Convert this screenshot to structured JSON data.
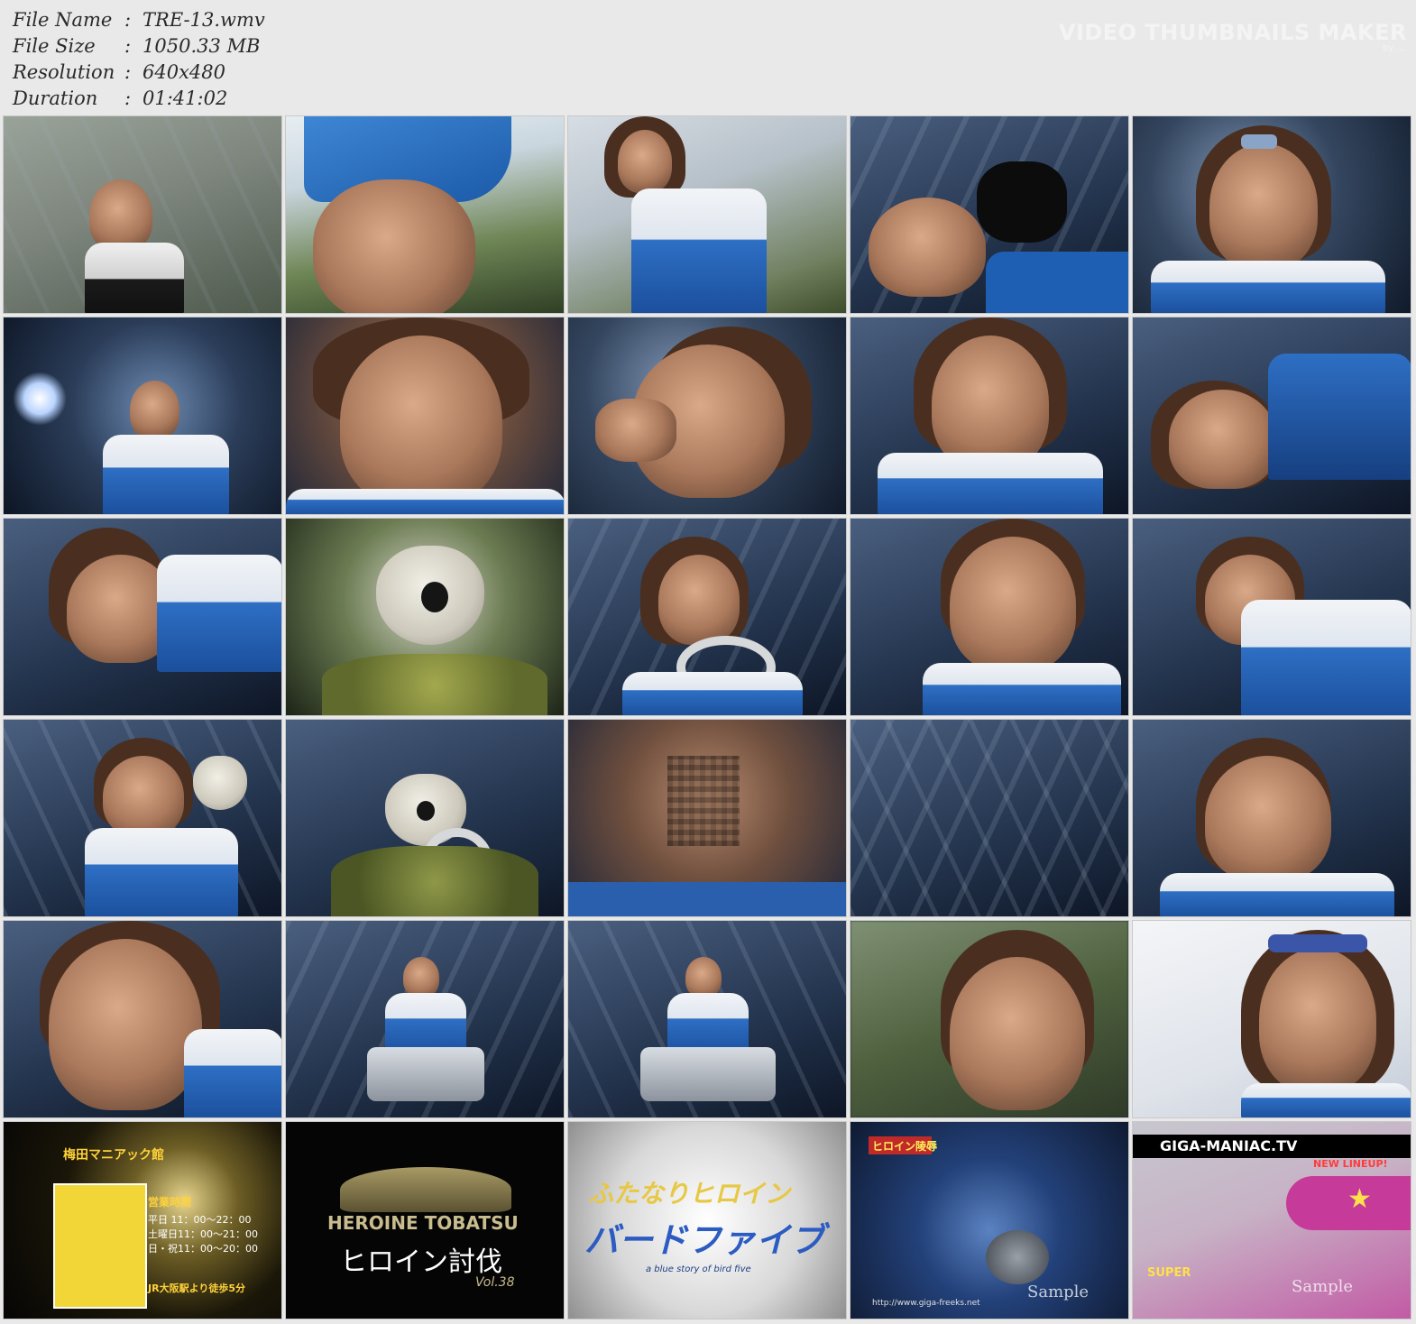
{
  "info": {
    "rows": [
      {
        "label": "File Name",
        "sep": ":",
        "value": "TRE-13.wmv"
      },
      {
        "label": "File Size",
        "sep": ":",
        "value": "1050.33 MB"
      },
      {
        "label": "Resolution",
        "sep": ":",
        "value": "640x480"
      },
      {
        "label": "Duration",
        "sep": ":",
        "value": "01:41:02"
      }
    ]
  },
  "watermark": {
    "title": "VIDEO THUMBNAILS MAKER",
    "subtitle": "by ..."
  },
  "thumbnails": [
    {
      "id": 1,
      "scene": "outdoor-net"
    },
    {
      "id": 2,
      "scene": "outdoor-skirt"
    },
    {
      "id": 3,
      "scene": "outdoor-standing"
    },
    {
      "id": 4,
      "scene": "dark-glove"
    },
    {
      "id": 5,
      "scene": "dark-face"
    },
    {
      "id": 6,
      "scene": "chained-light"
    },
    {
      "id": 7,
      "scene": "face-closeup"
    },
    {
      "id": 8,
      "scene": "face-hand"
    },
    {
      "id": 9,
      "scene": "face-closeup"
    },
    {
      "id": 10,
      "scene": "face-tilted"
    },
    {
      "id": 11,
      "scene": "face-lying"
    },
    {
      "id": 12,
      "scene": "skull-monster"
    },
    {
      "id": 13,
      "scene": "face-hose"
    },
    {
      "id": 14,
      "scene": "face-closeup"
    },
    {
      "id": 15,
      "scene": "face-lying"
    },
    {
      "id": 16,
      "scene": "face-monster"
    },
    {
      "id": 17,
      "scene": "skull-monster"
    },
    {
      "id": 18,
      "scene": "mosaic"
    },
    {
      "id": 19,
      "scene": "cage-bars"
    },
    {
      "id": 20,
      "scene": "face-tilted"
    },
    {
      "id": 21,
      "scene": "face-closeup"
    },
    {
      "id": 22,
      "scene": "cage-seated"
    },
    {
      "id": 23,
      "scene": "cage-seated"
    },
    {
      "id": 24,
      "scene": "outdoor-blur"
    },
    {
      "id": 25,
      "scene": "light-face"
    },
    {
      "id": 26,
      "scene": "map-ad"
    },
    {
      "id": 27,
      "scene": "title-card"
    },
    {
      "id": 28,
      "scene": "title-card-2"
    },
    {
      "id": 29,
      "scene": "sample-closeup"
    },
    {
      "id": 30,
      "scene": "sample-pink"
    }
  ],
  "card_text": {
    "map_title": "梅田マニアック館",
    "map_hours_title": "営業時間",
    "map_hours_1": "平日 11：00〜22：00",
    "map_hours_2": "土曜日11：00〜21：00",
    "map_hours_3": "日・祝11：00〜20：00",
    "map_access": "JR大阪駅より徒歩5分",
    "logo_en": "HEROINE TOBATSU",
    "logo_jp": "ヒロイン討伐",
    "logo_vol": "Vol.38",
    "title2_line1": "ふたなりヒロイン",
    "title2_line2": "バードファイブ",
    "title2_sub": "a blue story of bird five",
    "sample_label": "Sample",
    "sample_url": "http://www.giga-freeks.net",
    "giga_banner": "GIGA-MANIAC.TV",
    "new_lineup": "NEW LINEUP!",
    "super_label": "SUPER",
    "heroine_badge": "ヒロイン陵辱"
  }
}
